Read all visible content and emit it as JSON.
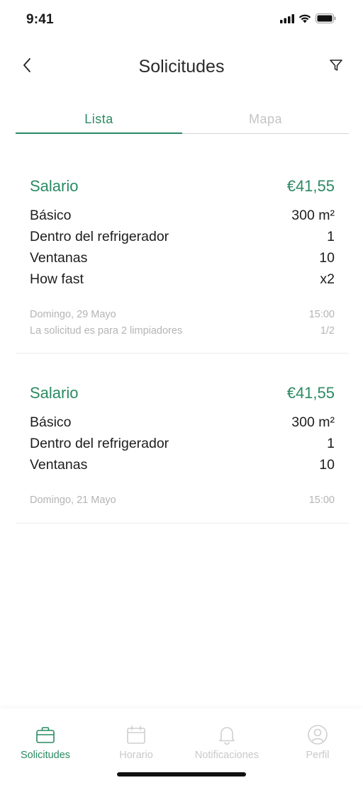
{
  "status_bar": {
    "time": "9:41",
    "icons": [
      "signal-icon",
      "wifi-icon",
      "battery-icon"
    ]
  },
  "header": {
    "title": "Solicitudes",
    "back_icon": "chevron-left-icon",
    "filter_icon": "filter-icon"
  },
  "tabs": [
    {
      "label": "Lista",
      "active": true
    },
    {
      "label": "Mapa",
      "active": false
    }
  ],
  "requests": [
    {
      "salary_label": "Salario",
      "salary_value": "€41,55",
      "items": [
        {
          "label": "Básico",
          "value": "300 m²"
        },
        {
          "label": "Dentro del refrigerador",
          "value": "1"
        },
        {
          "label": "Ventanas",
          "value": "10"
        },
        {
          "label": "How fast",
          "value": "x2"
        }
      ],
      "date": "Domingo, 29 Mayo",
      "time": "15:00",
      "note": "La solicitud es para 2 limpiadores",
      "note_count": "1/2"
    },
    {
      "salary_label": "Salario",
      "salary_value": "€41,55",
      "items": [
        {
          "label": "Básico",
          "value": "300 m²"
        },
        {
          "label": "Dentro del refrigerador",
          "value": "1"
        },
        {
          "label": "Ventanas",
          "value": "10"
        }
      ],
      "date": "Domingo, 21 Mayo",
      "time": "15:00"
    }
  ],
  "bottom_nav": [
    {
      "label": "Solicitudes",
      "icon": "briefcase-icon",
      "active": true
    },
    {
      "label": "Horario",
      "icon": "calendar-icon",
      "active": false
    },
    {
      "label": "Notificaciones",
      "icon": "bell-icon",
      "active": false
    },
    {
      "label": "Perfil",
      "icon": "profile-icon",
      "active": false
    }
  ],
  "colors": {
    "accent": "#2a8a63",
    "muted": "#b4b4b4",
    "inactive": "#c9c9c9"
  }
}
